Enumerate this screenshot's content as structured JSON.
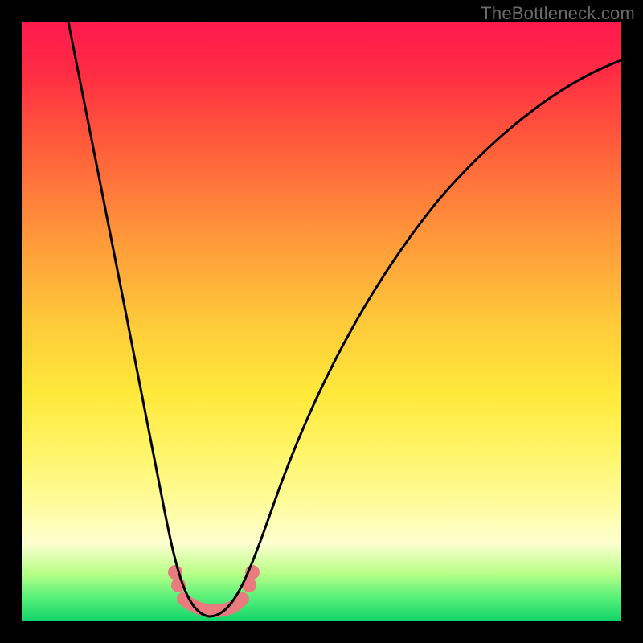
{
  "watermark": "TheBottleneck.com",
  "chart_data": {
    "type": "line",
    "title": "",
    "xlabel": "",
    "ylabel": "",
    "xlim": [
      0,
      100
    ],
    "ylim": [
      0,
      100
    ],
    "grid": false,
    "legend": false,
    "series": [
      {
        "name": "bottleneck-curve",
        "x": [
          8,
          12,
          16,
          20,
          23,
          25,
          27,
          29,
          30,
          33,
          36,
          40,
          45,
          52,
          60,
          70,
          82,
          95,
          100
        ],
        "y": [
          100,
          82,
          62,
          42,
          26,
          15,
          8,
          3,
          0,
          0,
          3,
          10,
          22,
          38,
          54,
          67,
          78,
          87,
          90
        ]
      }
    ],
    "highlight_band": {
      "color": "#e97a7e",
      "x_start": 25,
      "x_end": 37,
      "note": "low-bottleneck region near curve minimum"
    }
  }
}
